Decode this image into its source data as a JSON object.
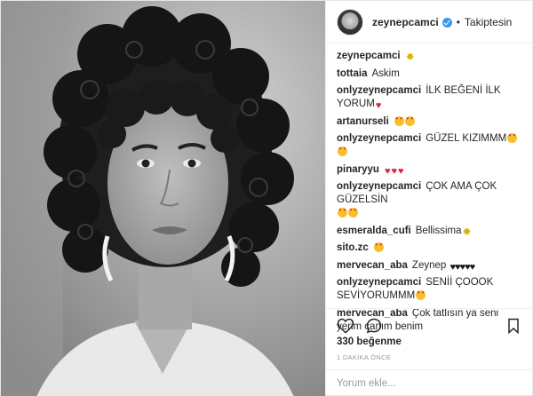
{
  "header": {
    "username": "zeynepcamci",
    "dot": "•",
    "follow_label": "Takiptesin"
  },
  "comments": [
    {
      "user": "zeynepcamci",
      "text": "",
      "emoji": [
        "sparkle"
      ]
    },
    {
      "user": "tottaia",
      "text": "Askim",
      "emoji": []
    },
    {
      "user": "onlyzeynepcamci",
      "text": "İLK BEĞENİ İLK YORUM",
      "emoji": [
        "heart"
      ]
    },
    {
      "user": "artanurseli",
      "text": "",
      "emoji": [
        "heart-eyes",
        "heart-eyes"
      ]
    },
    {
      "user": "onlyzeynepcamci",
      "text": "GÜZEL KIZIMMM",
      "emoji": [
        "heart-eyes",
        "heart-eyes"
      ]
    },
    {
      "user": "pinaryyu",
      "text": "",
      "emoji": [
        "heart",
        "heart",
        "heart"
      ]
    },
    {
      "user": "onlyzeynepcamci",
      "text": "ÇOK AMA ÇOK GÜZELSİN",
      "emoji": [
        "heart-eyes",
        "heart-eyes"
      ]
    },
    {
      "user": "esmeralda_cufi",
      "text": "Bellissima",
      "emoji": [
        "sparkle"
      ]
    },
    {
      "user": "sito.zc",
      "text": "",
      "emoji": [
        "heart-eyes"
      ]
    },
    {
      "user": "mervecan_aba",
      "text": "Zeynep",
      "emoji": [
        "black-heart",
        "black-heart",
        "black-heart",
        "black-heart",
        "black-heart"
      ]
    },
    {
      "user": "onlyzeynepcamci",
      "text": "SENİİ ÇOOOK SEVİYORUMMM",
      "emoji": [
        "heart-eyes"
      ]
    },
    {
      "user": "mervecan_aba",
      "text": "Çok tatlısın ya seni yerim canım benim",
      "emoji": []
    }
  ],
  "actions": {
    "like_icon": "heart-outline-icon",
    "comment_icon": "comment-bubble-icon",
    "save_icon": "bookmark-icon"
  },
  "likes_text": "330 beğenme",
  "time_text": "1 DAKİKA ÖNCE",
  "add_comment": {
    "placeholder": "Yorum ekle..."
  }
}
